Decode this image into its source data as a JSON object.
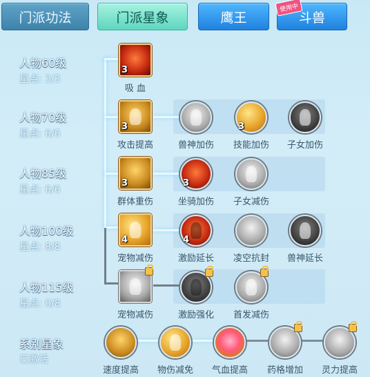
{
  "tabs": [
    {
      "label": "门派功法"
    },
    {
      "label": "门派星象"
    },
    {
      "label": "鹰王"
    },
    {
      "label": "斗兽",
      "badge": "使用中"
    }
  ],
  "levels": [
    {
      "title": "人物60级",
      "points": "星点: 3/3"
    },
    {
      "title": "人物70级",
      "points": "星点: 6/6"
    },
    {
      "title": "人物85级",
      "points": "星点: 6/6"
    },
    {
      "title": "人物100级",
      "points": "星点: 8/8"
    },
    {
      "title": "人物115级",
      "points": "星点: 0/8"
    },
    {
      "title": "系别星象",
      "points": "已激活"
    }
  ],
  "nodes": {
    "r1": [
      {
        "label": "吸 血",
        "count": "3"
      }
    ],
    "r2": [
      {
        "label": "攻击提高",
        "count": "3"
      },
      {
        "label": "兽神加伤",
        "count": ""
      },
      {
        "label": "技能加伤",
        "count": "3"
      },
      {
        "label": "子女加伤",
        "count": ""
      }
    ],
    "r3": [
      {
        "label": "群体重伤",
        "count": "3"
      },
      {
        "label": "坐骑加伤",
        "count": "3"
      },
      {
        "label": "子女减伤",
        "count": ""
      }
    ],
    "r4": [
      {
        "label": "宠物减伤",
        "count": "4"
      },
      {
        "label": "激励延长",
        "count": "4"
      },
      {
        "label": "凌空抗封",
        "count": ""
      },
      {
        "label": "兽神延长",
        "count": ""
      }
    ],
    "r5": [
      {
        "label": "宠物减伤",
        "count": ""
      },
      {
        "label": "激励强化",
        "count": ""
      },
      {
        "label": "首发减伤",
        "count": ""
      }
    ],
    "r6": [
      {
        "label": "速度提高"
      },
      {
        "label": "物伤减免"
      },
      {
        "label": "气血提高"
      },
      {
        "label": "药格增加"
      },
      {
        "label": "灵力提高"
      }
    ]
  }
}
